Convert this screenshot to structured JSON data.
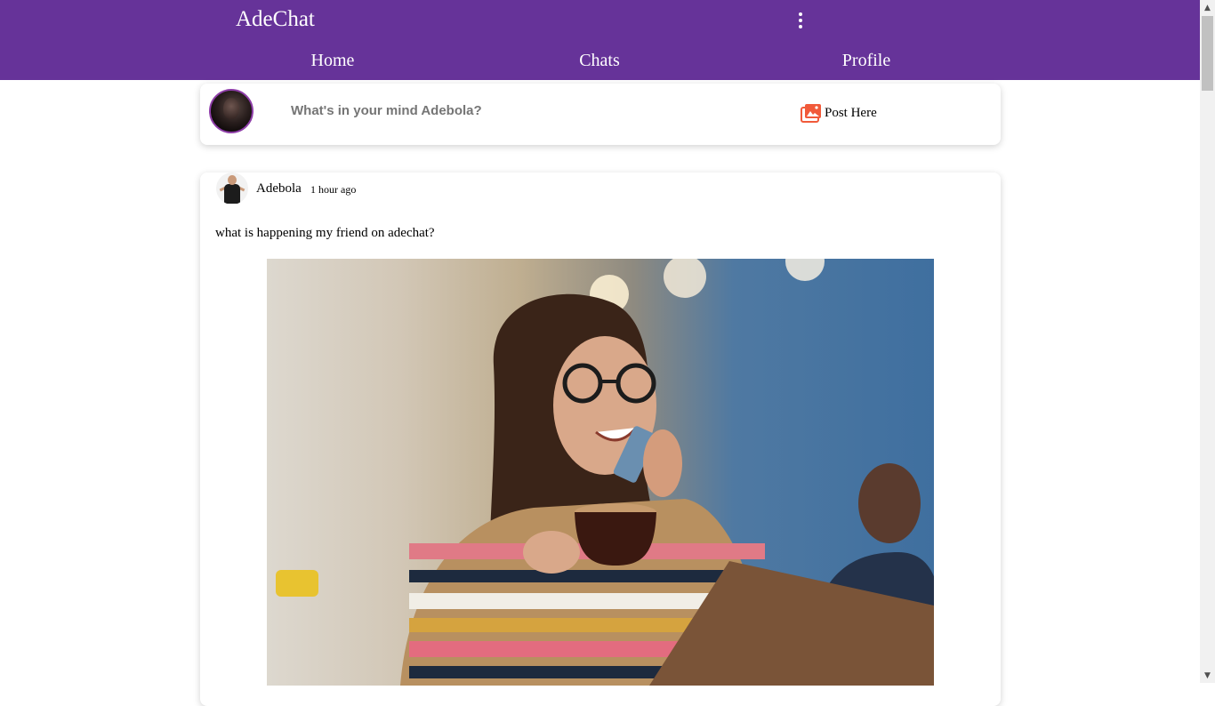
{
  "app": {
    "brand": "AdeChat",
    "accent_color": "#663399",
    "menu_icon": "more-vert-icon"
  },
  "nav": {
    "tabs": [
      {
        "label": "Home"
      },
      {
        "label": "Chats"
      },
      {
        "label": "Profile"
      }
    ]
  },
  "composer": {
    "placeholder": "What's in your mind Adebola?",
    "post_button_icon": "photo-library-icon",
    "post_button_label": "Post Here"
  },
  "post": {
    "author": "Adebola",
    "time": "1 hour ago",
    "text": "what is happening my friend on adechat?",
    "image_alt_desc": ""
  }
}
